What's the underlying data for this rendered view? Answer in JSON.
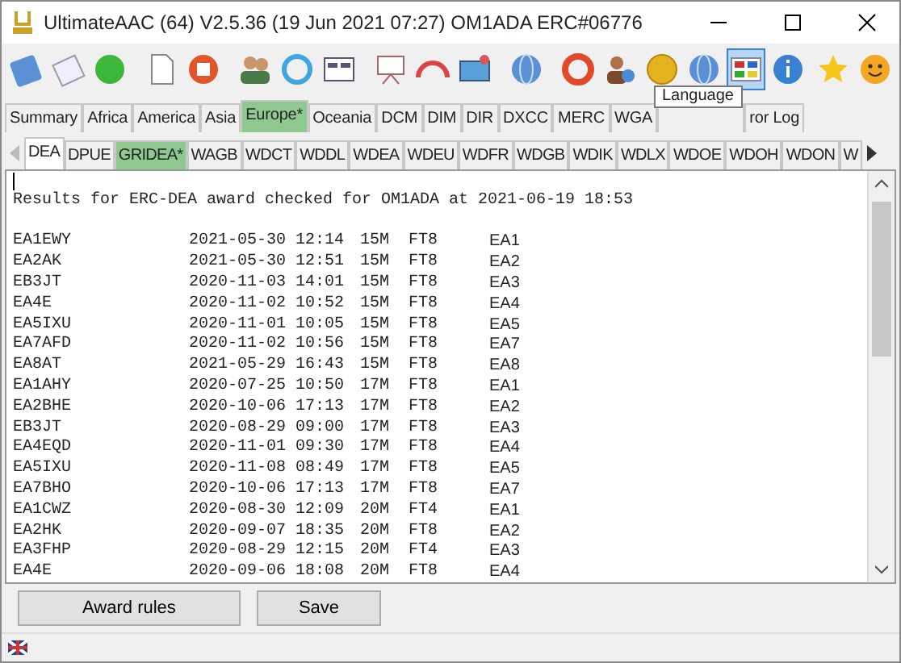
{
  "window": {
    "title": "UltimateAAC (64) V2.5.36 (19 Jun 2021 07:27) OM1ADA ERC#06776"
  },
  "toolbar": [
    {
      "kind": "book",
      "pressed": false
    },
    {
      "kind": "note",
      "pressed": false
    },
    {
      "kind": "ball",
      "pressed": false
    },
    {
      "kind": "separator"
    },
    {
      "kind": "document",
      "pressed": false
    },
    {
      "kind": "stop",
      "pressed": false
    },
    {
      "kind": "separator"
    },
    {
      "kind": "people",
      "pressed": false
    },
    {
      "kind": "refresh",
      "pressed": false
    },
    {
      "kind": "panels",
      "pressed": false
    },
    {
      "kind": "separator"
    },
    {
      "kind": "easel",
      "pressed": false
    },
    {
      "kind": "gauge",
      "pressed": false
    },
    {
      "kind": "picture",
      "pressed": false
    },
    {
      "kind": "separator"
    },
    {
      "kind": "globe",
      "pressed": false
    },
    {
      "kind": "separator"
    },
    {
      "kind": "lifebuoy",
      "pressed": false
    },
    {
      "kind": "person",
      "pressed": false
    },
    {
      "kind": "coin",
      "pressed": false
    },
    {
      "kind": "globe",
      "pressed": false
    },
    {
      "kind": "flags",
      "pressed": true
    },
    {
      "kind": "info",
      "pressed": false
    },
    {
      "kind": "spacer"
    },
    {
      "kind": "star",
      "pressed": false
    },
    {
      "kind": "smiley",
      "pressed": false
    }
  ],
  "tooltip": "Language",
  "main_tabs": [
    {
      "label": "Summary",
      "selected": false,
      "highlighted": false
    },
    {
      "label": "Africa",
      "selected": false,
      "highlighted": false
    },
    {
      "label": "America",
      "selected": false,
      "highlighted": false
    },
    {
      "label": "Asia",
      "selected": false,
      "highlighted": false
    },
    {
      "label": "Europe*",
      "selected": true,
      "highlighted": true
    },
    {
      "label": "Oceania",
      "selected": false,
      "highlighted": false
    },
    {
      "label": "DCM",
      "selected": false,
      "highlighted": false
    },
    {
      "label": "DIM",
      "selected": false,
      "highlighted": false
    },
    {
      "label": "DIR",
      "selected": false,
      "highlighted": false
    },
    {
      "label": "DXCC",
      "selected": false,
      "highlighted": false
    },
    {
      "label": "MERC",
      "selected": false,
      "highlighted": false
    },
    {
      "label": "WGA",
      "selected": false,
      "highlighted": false
    },
    {
      "selected": false,
      "highlighted": false
    },
    {
      "label": "ror Log",
      "selected": false,
      "highlighted": false
    }
  ],
  "award_tabs": [
    {
      "label": "DEA",
      "selected": true,
      "highlighted": false
    },
    {
      "label": "DPUE",
      "selected": false,
      "highlighted": false
    },
    {
      "label": "GRIDEA*",
      "selected": false,
      "highlighted": true
    },
    {
      "label": "WAGB",
      "selected": false,
      "highlighted": false
    },
    {
      "label": "WDCT",
      "selected": false,
      "highlighted": false
    },
    {
      "label": "WDDL",
      "selected": false,
      "highlighted": false
    },
    {
      "label": "WDEA",
      "selected": false,
      "highlighted": false
    },
    {
      "label": "WDEU",
      "selected": false,
      "highlighted": false
    },
    {
      "label": "WDFR",
      "selected": false,
      "highlighted": false
    },
    {
      "label": "WDGB",
      "selected": false,
      "highlighted": false
    },
    {
      "label": "WDIK",
      "selected": false,
      "highlighted": false
    },
    {
      "label": "WDLX",
      "selected": false,
      "highlighted": false
    },
    {
      "label": "WDOE",
      "selected": false,
      "highlighted": false
    },
    {
      "label": "WDOH",
      "selected": false,
      "highlighted": false
    },
    {
      "label": "WDON",
      "selected": false,
      "highlighted": false
    },
    {
      "label": "W",
      "selected": false,
      "highlighted": false
    }
  ],
  "results": {
    "header": "Results for ERC-DEA award checked for OM1ADA at 2021-06-19 18:53",
    "rows": [
      [
        "EA1EWY",
        "2021-05-30",
        "12:14",
        "15M",
        "FT8",
        "EA1"
      ],
      [
        "EA2AK",
        "2021-05-30",
        "12:51",
        "15M",
        "FT8",
        "EA2"
      ],
      [
        "EB3JT",
        "2020-11-03",
        "14:01",
        "15M",
        "FT8",
        "EA3"
      ],
      [
        "EA4E",
        "2020-11-02",
        "10:52",
        "15M",
        "FT8",
        "EA4"
      ],
      [
        "EA5IXU",
        "2020-11-01",
        "10:05",
        "15M",
        "FT8",
        "EA5"
      ],
      [
        "EA7AFD",
        "2020-11-02",
        "10:56",
        "15M",
        "FT8",
        "EA7"
      ],
      [
        "EA8AT",
        "2021-05-29",
        "16:43",
        "15M",
        "FT8",
        "EA8"
      ],
      [
        "EA1AHY",
        "2020-07-25",
        "10:50",
        "17M",
        "FT8",
        "EA1"
      ],
      [
        "EA2BHE",
        "2020-10-06",
        "17:13",
        "17M",
        "FT8",
        "EA2"
      ],
      [
        "EB3JT",
        "2020-08-29",
        "09:00",
        "17M",
        "FT8",
        "EA3"
      ],
      [
        "EA4EQD",
        "2020-11-01",
        "09:30",
        "17M",
        "FT8",
        "EA4"
      ],
      [
        "EA5IXU",
        "2020-11-08",
        "08:49",
        "17M",
        "FT8",
        "EA5"
      ],
      [
        "EA7BHO",
        "2020-10-06",
        "17:13",
        "17M",
        "FT8",
        "EA7"
      ],
      [
        "EA1CWZ",
        "2020-08-30",
        "12:09",
        "20M",
        "FT4",
        "EA1"
      ],
      [
        "EA2HK",
        "2020-09-07",
        "18:35",
        "20M",
        "FT8",
        "EA2"
      ],
      [
        "EA3FHP",
        "2020-08-29",
        "12:15",
        "20M",
        "FT4",
        "EA3"
      ],
      [
        "EA4E",
        "2020-09-06",
        "18:08",
        "20M",
        "FT8",
        "EA4"
      ]
    ]
  },
  "buttons": [
    "Award rules",
    "Save"
  ]
}
